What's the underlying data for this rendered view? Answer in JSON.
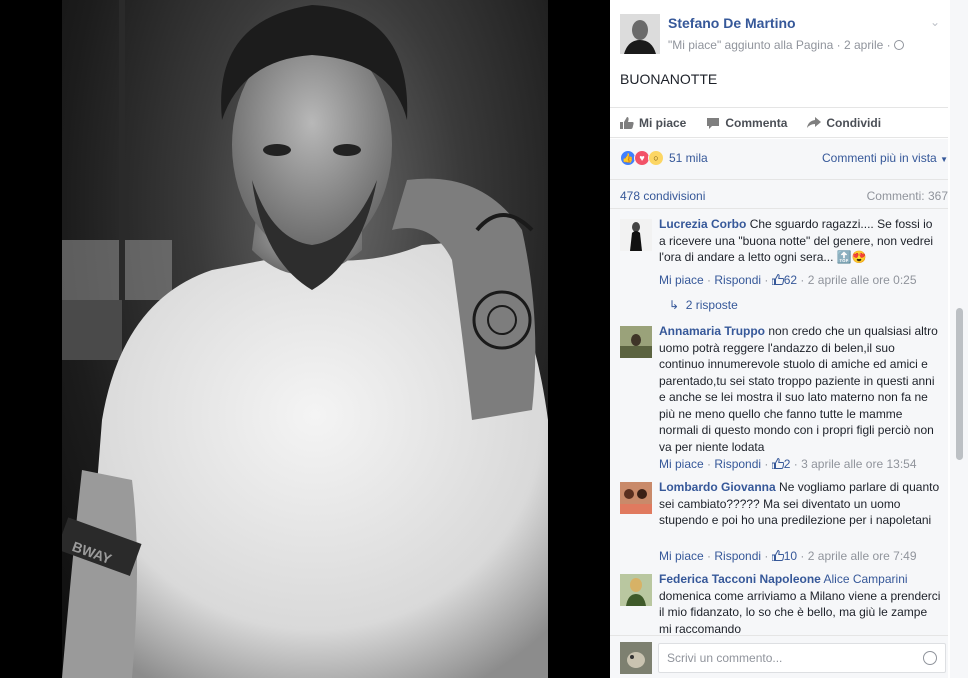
{
  "post": {
    "page_name": "Stefano De Martino",
    "meta_text": "\"Mi piace\" aggiunto alla Pagina · 2 aprile ·",
    "text": "BUONANOTTE"
  },
  "actions": {
    "like": "Mi piace",
    "comment": "Commenta",
    "share": "Condividi"
  },
  "reactions": {
    "count": "51 mila",
    "sort_label": "Commenti più in vista"
  },
  "stats": {
    "shares": "478 condivisioni",
    "comments": "Commenti: 367"
  },
  "comments": [
    {
      "author": "Lucrezia Corbo",
      "text": "Che sguardo ragazzi.... Se fossi io a ricevere una \"buona notte\" del genere, non vedrei l'ora di andare a letto ogni sera...",
      "emoji": "🔝😍",
      "like_label": "Mi piace",
      "reply_label": "Rispondi",
      "likes": "62",
      "time": "2 aprile alle ore 0:25",
      "replies": "2 risposte"
    },
    {
      "author": "Annamaria Truppo",
      "text": "non credo che un qualsiasi altro uomo potrà reggere l'andazzo di belen,il suo continuo innumerevole stuolo di amiche ed amici e parentado,tu sei stato troppo paziente in questi anni e anche se lei mostra il suo lato materno non fa ne più ne meno quello che fanno tutte le mamme normali di questo mondo con i propri figli perciò non va per niente lodata",
      "like_label": "Mi piace",
      "reply_label": "Rispondi",
      "likes": "2",
      "time": "3 aprile alle ore 13:54"
    },
    {
      "author": "Lombardo Giovanna",
      "text": "Ne vogliamo parlare di quanto sei cambiato????? Ma sei diventato un uomo stupendo e poi ho una predilezione per i napoletani",
      "like_label": "Mi piace",
      "reply_label": "Rispondi",
      "likes": "10",
      "time": "2 aprile alle ore 7:49"
    },
    {
      "author": "Federica Tacconi Napoleone",
      "tagged": "Alice Camparini",
      "text": "domenica come arriviamo a Milano viene a prenderci il mio fidanzato, lo so che è bello, ma giù le zampe mi raccomando"
    }
  ],
  "compose": {
    "placeholder": "Scrivi un commento..."
  },
  "colors": {
    "link": "#365899",
    "meta": "#90949c",
    "ufi_bg": "#f6f7f9"
  },
  "tattoo_text": "BWAY"
}
